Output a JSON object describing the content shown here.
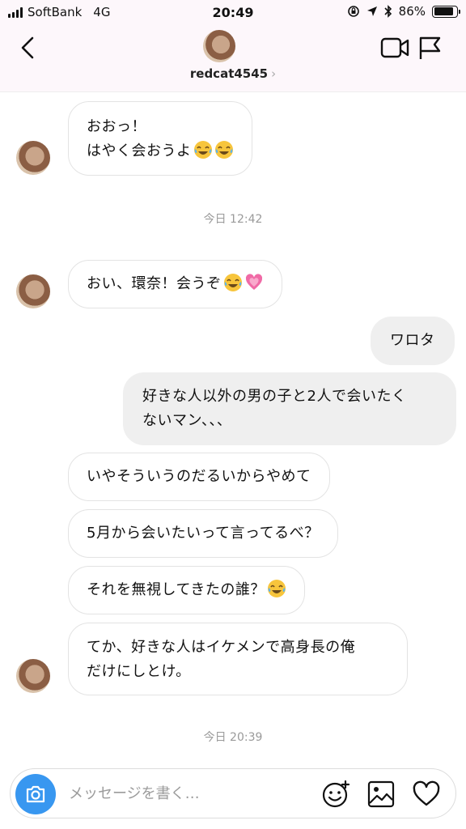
{
  "status_bar": {
    "carrier": "SoftBank",
    "network": "4G",
    "time": "20:49",
    "battery": "86%",
    "battery_level": 0.86,
    "icons": [
      "signal-icon",
      "orientation-lock-icon",
      "location-icon",
      "bluetooth-icon",
      "battery-icon"
    ]
  },
  "header": {
    "username": "redcat4545",
    "chevron": "›",
    "icons": [
      "back-icon",
      "video-call-icon",
      "flag-icon"
    ]
  },
  "messages": [
    {
      "side": "in",
      "line1": "おおっ！",
      "line2": "はやく会おうよ",
      "emoji": [
        "laugh-cry-emoji",
        "laugh-cry-emoji"
      ]
    },
    {
      "type": "timestamp",
      "text": "今日 12:42"
    },
    {
      "side": "in",
      "text": "おい、環奈！会うぞ",
      "emoji": [
        "laugh-cry-emoji",
        "pink-heart-emoji"
      ]
    },
    {
      "side": "out",
      "text": "ワロタ"
    },
    {
      "side": "out",
      "line1": "好きな人以外の男の子と2人で会いたく",
      "line2": "ないマン、、、"
    },
    {
      "side": "in",
      "text": "いやそういうのだるいからやめて"
    },
    {
      "side": "in",
      "text": "5月から会いたいって言ってるべ？"
    },
    {
      "side": "in",
      "text": "それを無視してきたの誰？",
      "emoji": [
        "laugh-cry-emoji"
      ]
    },
    {
      "side": "in",
      "line1": "てか、好きな人はイケメンで高身長の俺",
      "line2": "だけにしとけ。"
    },
    {
      "type": "timestamp",
      "text": "今日 20:39"
    }
  ],
  "composer": {
    "placeholder": "メッセージを書く…",
    "icons": [
      "camera-icon",
      "sticker-icon",
      "gallery-icon",
      "heart-icon"
    ]
  },
  "colors": {
    "header_bg": "#fdf7fb",
    "camera_button": "#3897f0",
    "outgoing_bubble": "#efefef",
    "timestamp": "#9a9a9a"
  }
}
